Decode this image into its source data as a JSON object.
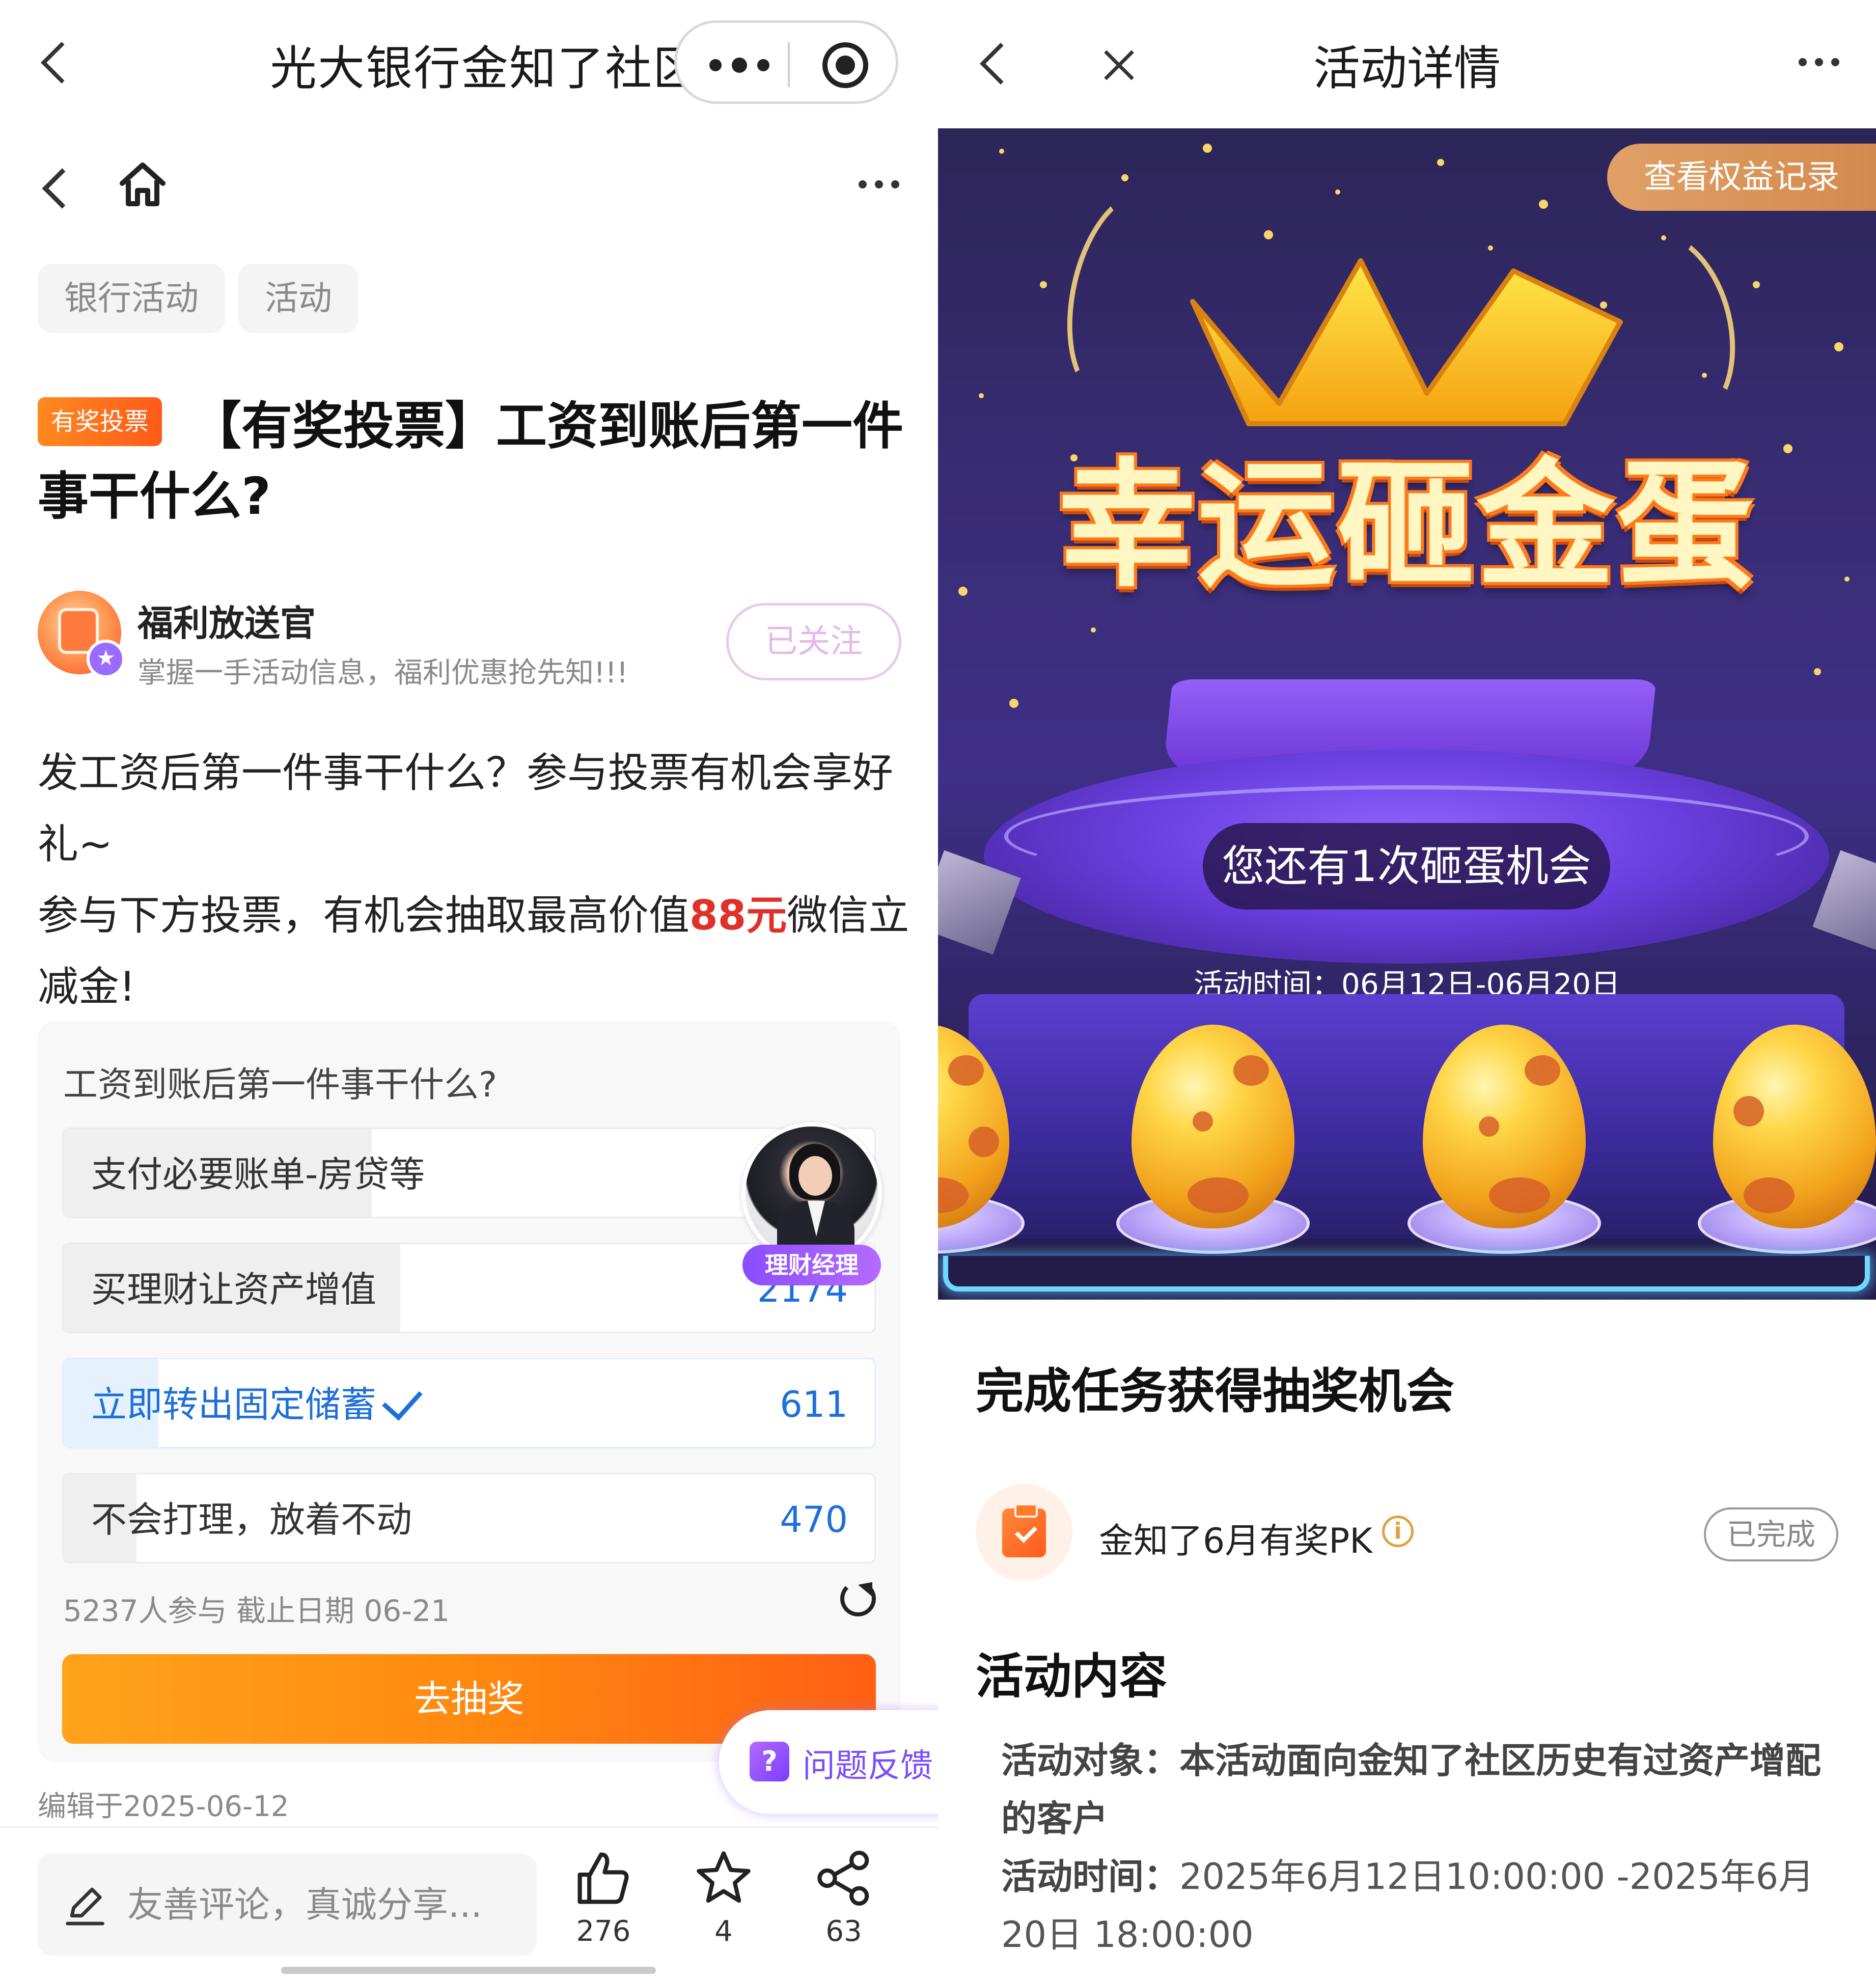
{
  "left": {
    "mini_title": "光大银行金知了社区",
    "tags": [
      "银行活动",
      "活动"
    ],
    "badge": "有奖投票",
    "post_title": "【有奖投票】工资到账后第一件事干什么?",
    "author": {
      "name": "福利放送官",
      "desc": "掌握一手活动信息，福利优惠抢先知!!!",
      "follow_label": "已关注"
    },
    "body": {
      "p1": "发工资后第一件事干什么？参与投票有机会享好礼~",
      "p2_pre": "参与下方投票，有机会抽取最高价值",
      "p2_highlight": "88元",
      "p2_post": "微信立减金!"
    },
    "vote": {
      "question": "工资到账后第一件事干什么?",
      "options": [
        {
          "label": "支付必要账单-房贷等",
          "count": "",
          "fraction": 0.38,
          "selected": false
        },
        {
          "label": "买理财让资产增值",
          "count": "2174",
          "fraction": 0.415,
          "selected": false
        },
        {
          "label": "立即转出固定储蓄",
          "count": "611",
          "fraction": 0.117,
          "selected": true
        },
        {
          "label": "不会打理，放着不动",
          "count": "470",
          "fraction": 0.09,
          "selected": false
        }
      ],
      "meta": "5237人参与   截止日期 06-21",
      "draw_label": "去抽奖"
    },
    "manager_tag": "理财经理",
    "feedback_label": "问题反馈",
    "edited": "编辑于2025-06-12",
    "comment_placeholder": "友善评论，真诚分享...",
    "actions": {
      "likes": "276",
      "favorites": "4",
      "shares": "63"
    }
  },
  "right": {
    "title": "活动详情",
    "equity_label": "查看权益记录",
    "game_title": "幸运砸金蛋",
    "chances": "您还有1次砸蛋机会",
    "activity_time": "活动时间：06月12日-06月20日",
    "task_section_title": "完成任务获得抽奖机会",
    "task": {
      "name": "金知了6月有奖PK",
      "status": "已完成"
    },
    "content_section_title": "活动内容",
    "content": {
      "target_label": "活动对象：",
      "target_text": "本活动面向金知了社区历史有过资产增配的客户",
      "time_label": "活动时间：",
      "time_text": "2025年6月12日10:00:00 -2025年6月20日 18:00:00"
    }
  },
  "colors": {
    "accent_orange": "#ff8a10",
    "link_blue": "#1e6fd9",
    "highlight_red": "#e0302a",
    "banner_purple": "#3a2d77"
  }
}
